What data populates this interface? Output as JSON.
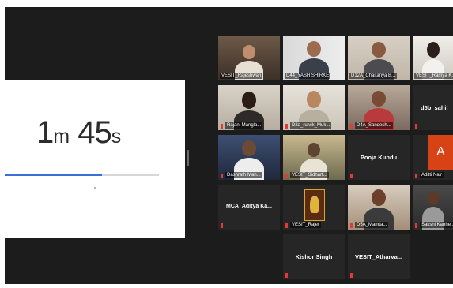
{
  "timer": {
    "minutes": "1",
    "minutes_unit": "m",
    "seconds": "45",
    "seconds_unit": "s",
    "progress_fraction": 0.63
  },
  "participants": [
    {
      "name": "VESIT_Rajeshwari"
    },
    {
      "name": "D44_YASH SHIRKE"
    },
    {
      "name": "D12A_Chaitanya B..."
    },
    {
      "name": "VESIT_Ramya K..."
    },
    {
      "name": "Rajani Mangla..."
    },
    {
      "name": "D2a_rutvik_Muk..."
    },
    {
      "name": "D4A_Sandesh..."
    },
    {
      "name": "d5b_sahil"
    },
    {
      "name": "Dashrath Mah..."
    },
    {
      "name": "VESIT_Sidhart..."
    },
    {
      "name": "Pooja Kundu"
    },
    {
      "name": "Aditti Nair"
    },
    {
      "name": "MCA_Aditya  Ka..."
    },
    {
      "name": "VESIT_Rajet"
    },
    {
      "name": "D5A_Mamta..."
    },
    {
      "name": "Sakshi Kanhe..."
    },
    {
      "name": "Kishor Singh"
    },
    {
      "name": "VESIT_Atharva..."
    }
  ],
  "avatar_letter": "A",
  "colors": {
    "accent": "#3b6fd6",
    "active_border": "#c9e24a",
    "muted": "#e53935",
    "avatar": "#d84315"
  }
}
